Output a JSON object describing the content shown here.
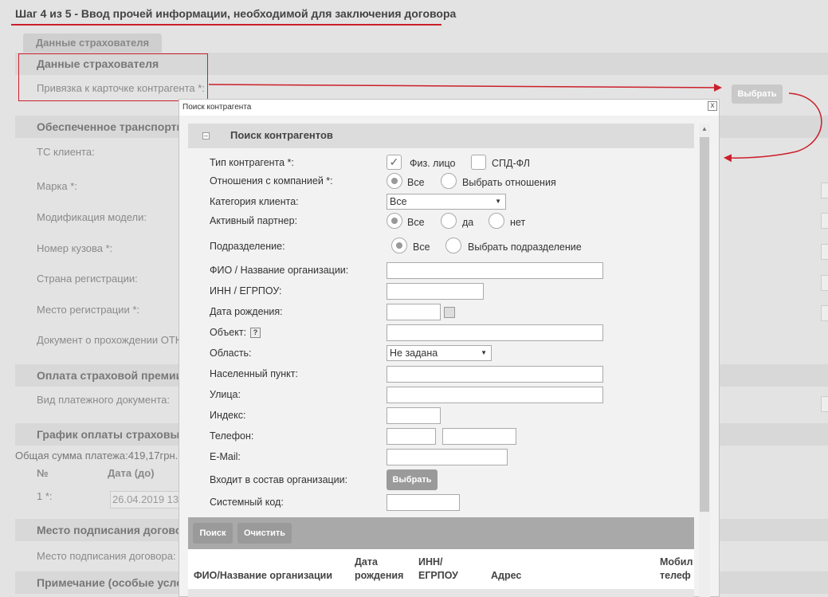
{
  "page": {
    "step_title": "Шаг 4 из 5 - Ввод прочей информации, необходимой для заключения договора",
    "tab_label": "Данные страхователя",
    "sections": [
      {
        "title": "Данные страхователя"
      },
      {
        "title": "Обеспеченное транспортное"
      },
      {
        "title": "Оплата страховой премии"
      },
      {
        "title": "График оплаты страховых"
      },
      {
        "title": "Место подписания договор"
      },
      {
        "title": "Примечание (особые услов"
      }
    ],
    "labels": {
      "counterparty_binding": "Привязка к карточке контрагента *:",
      "vehicle": "ТС клиента:",
      "brand": "Марка *:",
      "model_mod": "Модификация модели:",
      "body_number": "Номер кузова *:",
      "reg_country": "Страна регистрации:",
      "reg_place": "Место регистрации *:",
      "inspection_doc": "Документ о прохождении ОТК",
      "payment_doc_type": "Вид платежного документа:",
      "total_sum": "Общая сумма платежа:419,17грн.",
      "col_num": "№",
      "col_date": "Дата (до)",
      "row_1": "1 *:",
      "row_1_date": "26.04.2019 13",
      "sign_place": "Место подписания договора:"
    },
    "select_button": "Выбрать"
  },
  "dialog": {
    "title": "Поиск контрагента",
    "close": "x",
    "header": "Поиск контрагентов",
    "collapse": "–",
    "fields": {
      "type_label": "Тип контрагента *:",
      "type_opt1": "Физ. лицо",
      "type_opt2": "СПД-ФЛ",
      "relation_label": "Отношения с компанией *:",
      "relation_opt1": "Все",
      "relation_opt2": "Выбрать отношения",
      "category_label": "Категория клиента:",
      "category_value": "Все",
      "active_label": "Активный партнер:",
      "active_opt1": "Все",
      "active_opt2": "да",
      "active_opt3": "нет",
      "division_label": "Подразделение:",
      "division_opt1": "Все",
      "division_opt2": "Выбрать подразделение",
      "name_label": "ФИО / Название организации:",
      "inn_label": "ИНН / ЕГРПОУ:",
      "birth_label": "Дата рождения:",
      "object_label": "Объект:",
      "help": "?",
      "region_label": "Область:",
      "region_value": "Не задана",
      "settlement_label": "Населенный пункт:",
      "street_label": "Улица:",
      "index_label": "Индекс:",
      "phone_label": "Телефон:",
      "email_label": "E-Mail:",
      "org_member_label": "Входит в состав организации:",
      "org_member_button": "Выбрать",
      "sys_code_label": "Системный код:"
    },
    "actions": {
      "search": "Поиск",
      "clear": "Очистить"
    },
    "table_headers": [
      {
        "line1": "",
        "line2": "ФИО/Название организации"
      },
      {
        "line1": "Дата",
        "line2": "рождения"
      },
      {
        "line1": "ИНН/",
        "line2": "ЕГРПОУ"
      },
      {
        "line1": "",
        "line2": "Адрес"
      },
      {
        "line1": "Мобил",
        "line2": "телеф"
      }
    ]
  },
  "colors": {
    "annotation_red": "#cc1f2b",
    "button_gray": "#9a9a9a"
  }
}
